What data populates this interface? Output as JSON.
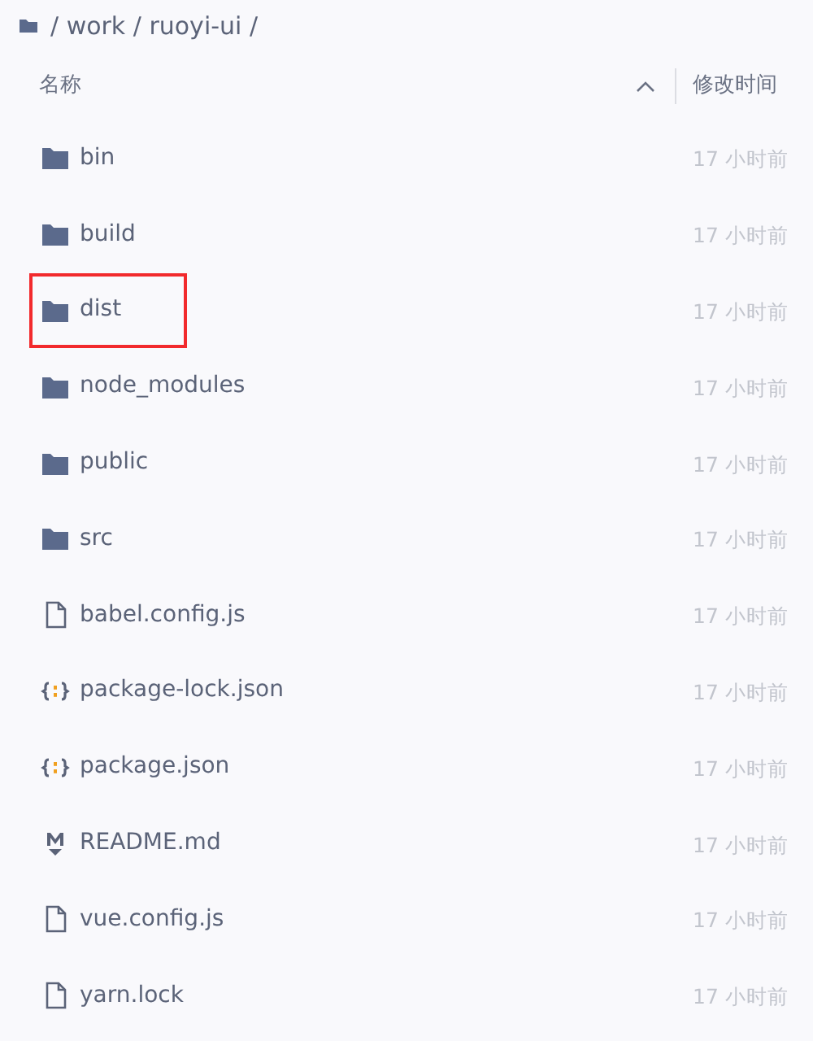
{
  "breadcrumb": {
    "path": "/ work / ruoyi-ui /"
  },
  "columns": [
    {
      "label": "名称",
      "sorted": true
    },
    {
      "label": "修改时间",
      "sorted": false
    }
  ],
  "rows": [
    {
      "kind": "folder",
      "name": "bin",
      "modified": "17 小时前",
      "highlighted": false
    },
    {
      "kind": "folder",
      "name": "build",
      "modified": "17 小时前",
      "highlighted": false
    },
    {
      "kind": "folder",
      "name": "dist",
      "modified": "17 小时前",
      "highlighted": true
    },
    {
      "kind": "folder",
      "name": "node_modules",
      "modified": "17 小时前",
      "highlighted": false
    },
    {
      "kind": "folder",
      "name": "public",
      "modified": "17 小时前",
      "highlighted": false
    },
    {
      "kind": "folder",
      "name": "src",
      "modified": "17 小时前",
      "highlighted": false
    },
    {
      "kind": "file",
      "name": "babel.config.js",
      "modified": "17 小时前",
      "highlighted": false
    },
    {
      "kind": "json",
      "name": "package-lock.json",
      "modified": "17 小时前",
      "highlighted": false
    },
    {
      "kind": "json",
      "name": "package.json",
      "modified": "17 小时前",
      "highlighted": false
    },
    {
      "kind": "markdown",
      "name": "README.md",
      "modified": "17 小时前",
      "highlighted": false
    },
    {
      "kind": "file",
      "name": "vue.config.js",
      "modified": "17 小时前",
      "highlighted": false
    },
    {
      "kind": "file",
      "name": "yarn.lock",
      "modified": "17 小时前",
      "highlighted": false
    }
  ]
}
